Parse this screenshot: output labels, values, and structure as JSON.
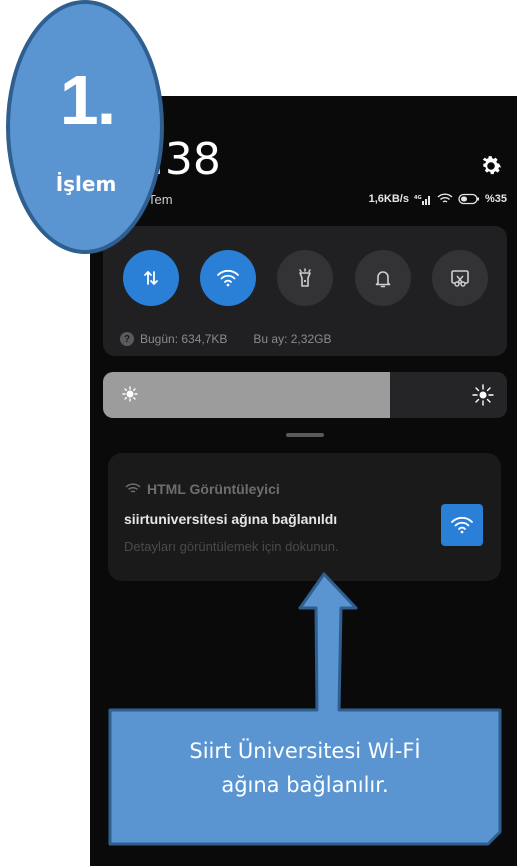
{
  "badge": {
    "number": "1.",
    "label": "İşlem"
  },
  "status": {
    "time": ":38",
    "date": "Tem",
    "network_speed": "1,6KB/s",
    "battery": "%35"
  },
  "quick_toggles": [
    {
      "name": "mobile-data",
      "icon": "data-arrows-icon",
      "active": true
    },
    {
      "name": "wifi",
      "icon": "wifi-icon",
      "active": true
    },
    {
      "name": "flashlight",
      "icon": "flashlight-icon",
      "active": false
    },
    {
      "name": "notifications",
      "icon": "bell-icon",
      "active": false
    },
    {
      "name": "screenshot",
      "icon": "screenshot-scissors-icon",
      "active": false
    }
  ],
  "usage": {
    "today": "Bugün: 634,7KB",
    "month": "Bu ay: 2,32GB"
  },
  "brightness": {
    "level": 0.71
  },
  "notification": {
    "app": "HTML Görüntüleyici",
    "title": "siirtuniversitesi ağına bağlanıldı",
    "subtitle": "Detayları görüntülemek için dokunun."
  },
  "callout": {
    "line1": "Siirt Üniversitesi Wİ-Fİ",
    "line2": "ağına bağlanılır."
  },
  "colors": {
    "accent_blue": "#2a7fd6",
    "annotation_blue": "#5a95d2",
    "annotation_border": "#2f5f8f",
    "panel_bg": "#202022",
    "screen_bg": "#0a0a0a"
  }
}
